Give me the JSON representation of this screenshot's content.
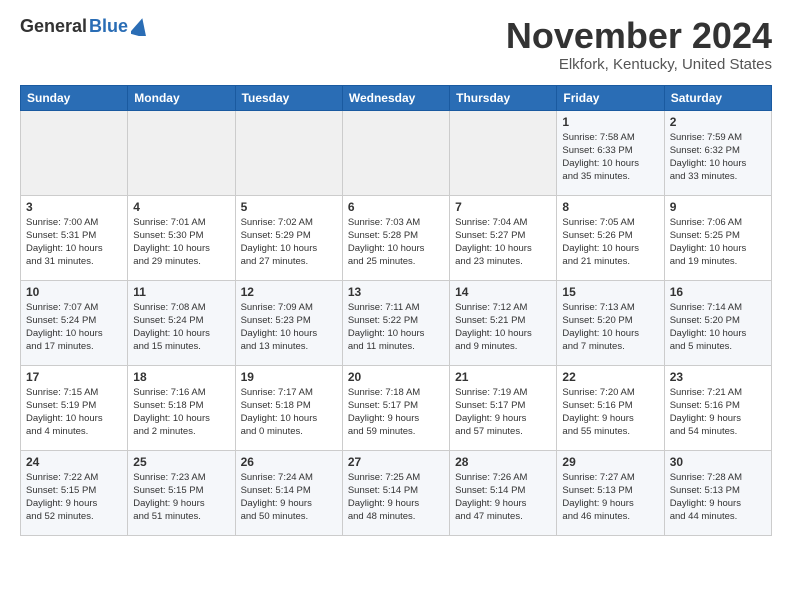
{
  "header": {
    "logo_general": "General",
    "logo_blue": "Blue",
    "month_title": "November 2024",
    "location": "Elkfork, Kentucky, United States"
  },
  "weekdays": [
    "Sunday",
    "Monday",
    "Tuesday",
    "Wednesday",
    "Thursday",
    "Friday",
    "Saturday"
  ],
  "weeks": [
    [
      {
        "day": "",
        "info": ""
      },
      {
        "day": "",
        "info": ""
      },
      {
        "day": "",
        "info": ""
      },
      {
        "day": "",
        "info": ""
      },
      {
        "day": "",
        "info": ""
      },
      {
        "day": "1",
        "info": "Sunrise: 7:58 AM\nSunset: 6:33 PM\nDaylight: 10 hours\nand 35 minutes."
      },
      {
        "day": "2",
        "info": "Sunrise: 7:59 AM\nSunset: 6:32 PM\nDaylight: 10 hours\nand 33 minutes."
      }
    ],
    [
      {
        "day": "3",
        "info": "Sunrise: 7:00 AM\nSunset: 5:31 PM\nDaylight: 10 hours\nand 31 minutes."
      },
      {
        "day": "4",
        "info": "Sunrise: 7:01 AM\nSunset: 5:30 PM\nDaylight: 10 hours\nand 29 minutes."
      },
      {
        "day": "5",
        "info": "Sunrise: 7:02 AM\nSunset: 5:29 PM\nDaylight: 10 hours\nand 27 minutes."
      },
      {
        "day": "6",
        "info": "Sunrise: 7:03 AM\nSunset: 5:28 PM\nDaylight: 10 hours\nand 25 minutes."
      },
      {
        "day": "7",
        "info": "Sunrise: 7:04 AM\nSunset: 5:27 PM\nDaylight: 10 hours\nand 23 minutes."
      },
      {
        "day": "8",
        "info": "Sunrise: 7:05 AM\nSunset: 5:26 PM\nDaylight: 10 hours\nand 21 minutes."
      },
      {
        "day": "9",
        "info": "Sunrise: 7:06 AM\nSunset: 5:25 PM\nDaylight: 10 hours\nand 19 minutes."
      }
    ],
    [
      {
        "day": "10",
        "info": "Sunrise: 7:07 AM\nSunset: 5:24 PM\nDaylight: 10 hours\nand 17 minutes."
      },
      {
        "day": "11",
        "info": "Sunrise: 7:08 AM\nSunset: 5:24 PM\nDaylight: 10 hours\nand 15 minutes."
      },
      {
        "day": "12",
        "info": "Sunrise: 7:09 AM\nSunset: 5:23 PM\nDaylight: 10 hours\nand 13 minutes."
      },
      {
        "day": "13",
        "info": "Sunrise: 7:11 AM\nSunset: 5:22 PM\nDaylight: 10 hours\nand 11 minutes."
      },
      {
        "day": "14",
        "info": "Sunrise: 7:12 AM\nSunset: 5:21 PM\nDaylight: 10 hours\nand 9 minutes."
      },
      {
        "day": "15",
        "info": "Sunrise: 7:13 AM\nSunset: 5:20 PM\nDaylight: 10 hours\nand 7 minutes."
      },
      {
        "day": "16",
        "info": "Sunrise: 7:14 AM\nSunset: 5:20 PM\nDaylight: 10 hours\nand 5 minutes."
      }
    ],
    [
      {
        "day": "17",
        "info": "Sunrise: 7:15 AM\nSunset: 5:19 PM\nDaylight: 10 hours\nand 4 minutes."
      },
      {
        "day": "18",
        "info": "Sunrise: 7:16 AM\nSunset: 5:18 PM\nDaylight: 10 hours\nand 2 minutes."
      },
      {
        "day": "19",
        "info": "Sunrise: 7:17 AM\nSunset: 5:18 PM\nDaylight: 10 hours\nand 0 minutes."
      },
      {
        "day": "20",
        "info": "Sunrise: 7:18 AM\nSunset: 5:17 PM\nDaylight: 9 hours\nand 59 minutes."
      },
      {
        "day": "21",
        "info": "Sunrise: 7:19 AM\nSunset: 5:17 PM\nDaylight: 9 hours\nand 57 minutes."
      },
      {
        "day": "22",
        "info": "Sunrise: 7:20 AM\nSunset: 5:16 PM\nDaylight: 9 hours\nand 55 minutes."
      },
      {
        "day": "23",
        "info": "Sunrise: 7:21 AM\nSunset: 5:16 PM\nDaylight: 9 hours\nand 54 minutes."
      }
    ],
    [
      {
        "day": "24",
        "info": "Sunrise: 7:22 AM\nSunset: 5:15 PM\nDaylight: 9 hours\nand 52 minutes."
      },
      {
        "day": "25",
        "info": "Sunrise: 7:23 AM\nSunset: 5:15 PM\nDaylight: 9 hours\nand 51 minutes."
      },
      {
        "day": "26",
        "info": "Sunrise: 7:24 AM\nSunset: 5:14 PM\nDaylight: 9 hours\nand 50 minutes."
      },
      {
        "day": "27",
        "info": "Sunrise: 7:25 AM\nSunset: 5:14 PM\nDaylight: 9 hours\nand 48 minutes."
      },
      {
        "day": "28",
        "info": "Sunrise: 7:26 AM\nSunset: 5:14 PM\nDaylight: 9 hours\nand 47 minutes."
      },
      {
        "day": "29",
        "info": "Sunrise: 7:27 AM\nSunset: 5:13 PM\nDaylight: 9 hours\nand 46 minutes."
      },
      {
        "day": "30",
        "info": "Sunrise: 7:28 AM\nSunset: 5:13 PM\nDaylight: 9 hours\nand 44 minutes."
      }
    ]
  ]
}
